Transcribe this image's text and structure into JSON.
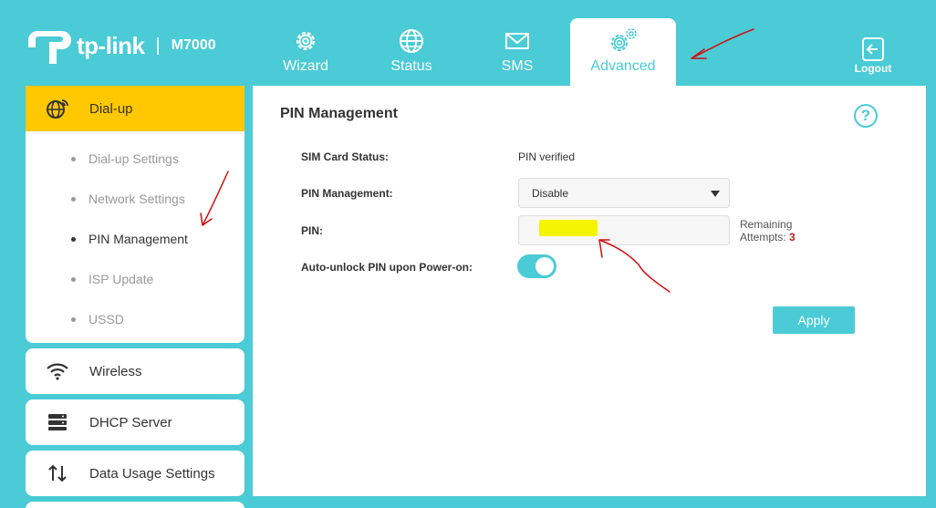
{
  "brand": {
    "name": "tp-link",
    "separator": "|",
    "model": "M7000"
  },
  "nav": {
    "tabs": [
      {
        "label": "Wizard",
        "icon": "gear-icon"
      },
      {
        "label": "Status",
        "icon": "globe-icon"
      },
      {
        "label": "SMS",
        "icon": "envelope-icon"
      },
      {
        "label": "Advanced",
        "icon": "gears-icon",
        "active": true
      }
    ],
    "logout_label": "Logout"
  },
  "sidebar": {
    "dialup": {
      "label": "Dial-up",
      "icon": "globe-wifi-icon",
      "items": [
        {
          "label": "Dial-up Settings"
        },
        {
          "label": "Network Settings"
        },
        {
          "label": "PIN Management",
          "current": true
        },
        {
          "label": "ISP Update"
        },
        {
          "label": "USSD"
        }
      ]
    },
    "others": [
      {
        "label": "Wireless",
        "icon": "wifi-icon"
      },
      {
        "label": "DHCP Server",
        "icon": "server-icon"
      },
      {
        "label": "Data Usage Settings",
        "icon": "arrows-updown-icon"
      }
    ]
  },
  "main": {
    "title": "PIN Management",
    "help": "?",
    "sim_status": {
      "label": "SIM Card Status:",
      "value": "PIN verified"
    },
    "pin_management": {
      "label": "PIN Management:",
      "selected": "Disable"
    },
    "pin": {
      "label": "PIN:",
      "remaining_label": "Remaining",
      "attempts_label": "Attempts:",
      "attempts": "3"
    },
    "auto_unlock": {
      "label": "Auto-unlock PIN upon Power-on:",
      "enabled": true
    },
    "apply_label": "Apply"
  },
  "colors": {
    "accent": "#4acbd6",
    "active_menu": "#ffc800",
    "highlight": "#f5f500",
    "annotation": "#d01010"
  }
}
